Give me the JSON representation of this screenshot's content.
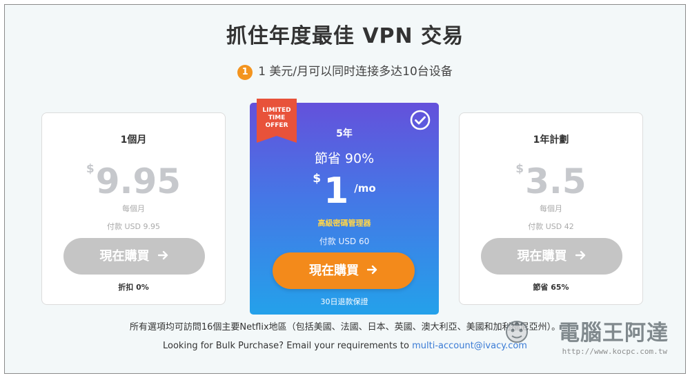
{
  "header": {
    "title": "抓住年度最佳 VPN 交易",
    "step_number": "1",
    "subtitle": "1 美元/月可以同时连接多达10台设备"
  },
  "plans": [
    {
      "name": "1個月",
      "currency": "$",
      "price": "9.95",
      "per": "每個月",
      "pay": "付款 USD 9.95",
      "button": "現在購買",
      "note": "折扣 0%"
    },
    {
      "ribbon": "LIMITED TIME OFFER",
      "name": "5年",
      "save": "節省 90%",
      "currency": "$",
      "price": "1",
      "unit": "/mo",
      "bonus": "高級密碼管理器",
      "pay": "付款 USD 60",
      "button": "現在購買",
      "guarantee": "30日退款保證"
    },
    {
      "name": "1年計劃",
      "currency": "$",
      "price": "3.5",
      "per": "每個月",
      "pay": "付款 USD 42",
      "button": "現在購買",
      "note": "節省 65%"
    }
  ],
  "footer": {
    "netflix_note": "所有選項均可訪問16個主要Netflix地區（包括美國、法國、日本、英國、澳大利亞、美國和加利福尼亞州）。",
    "bulk_text": "Looking for Bulk Purchase? Email your requirements to",
    "bulk_email": "multi-account@ivacy.com"
  },
  "watermark": {
    "title": "電腦王阿達",
    "url": "http://www.kocpc.com.tw"
  },
  "colors": {
    "accent_orange": "#f38a1b",
    "step_badge": "#f3941f",
    "featured_top": "#6451db",
    "featured_bottom": "#24a1ea",
    "ribbon": "#e8523a",
    "bonus_yellow": "#ffd54a",
    "disabled_button": "#c5c5c5",
    "link": "#3a7bd5"
  },
  "icons": {
    "check": "check-circle-icon",
    "arrow": "arrow-right-icon"
  }
}
